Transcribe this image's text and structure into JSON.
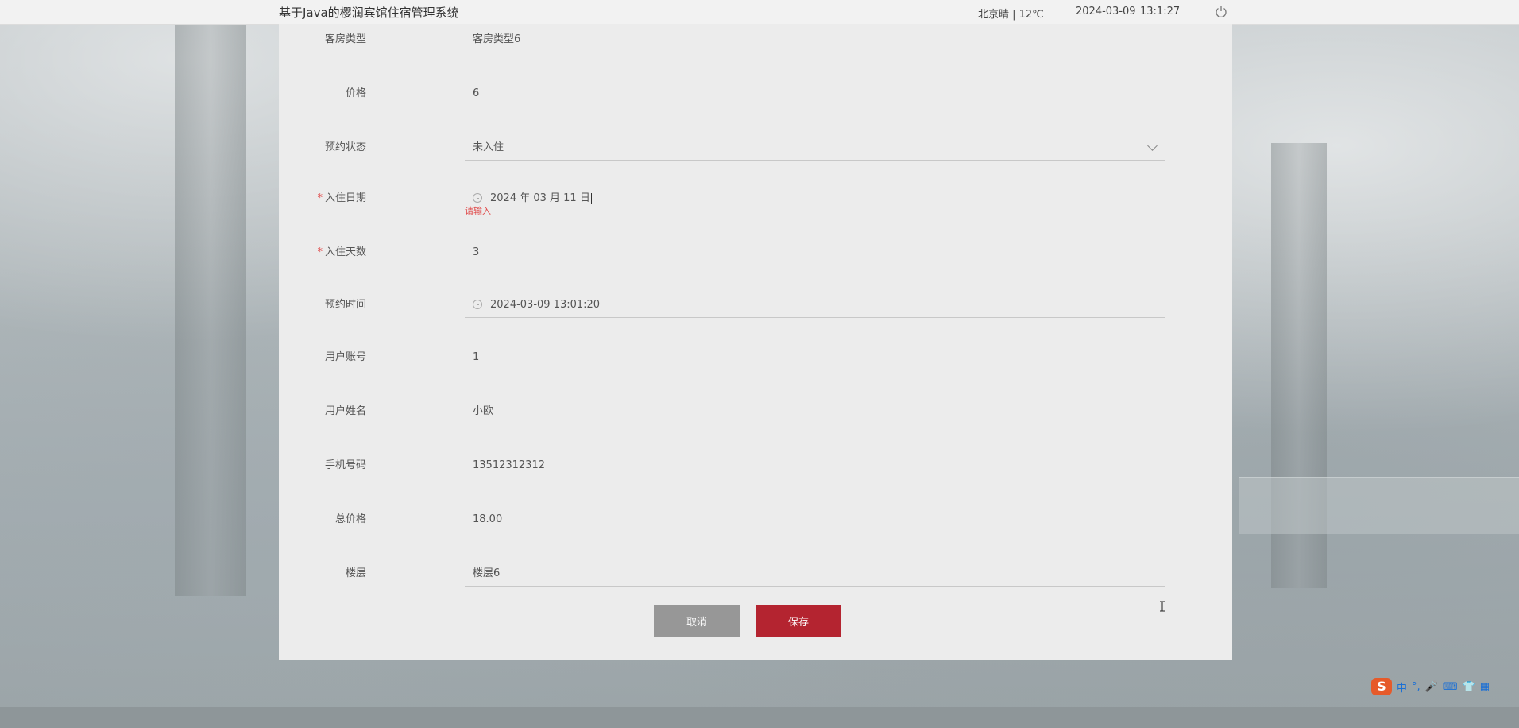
{
  "header": {
    "title": "基于Java的樱润宾馆住宿管理系统",
    "weather": "北京晴 | 12℃",
    "date": "2024-03-09",
    "time": "13:1:27"
  },
  "form": {
    "fields": [
      {
        "label": "客房类型",
        "value": "客房类型6",
        "required": false
      },
      {
        "label": "价格",
        "value": "6",
        "required": false
      },
      {
        "label": "预约状态",
        "value": "未入住",
        "required": false
      },
      {
        "label": "入住日期",
        "value": "2024 年 03 月 11 日",
        "required": true
      },
      {
        "label": "入住天数",
        "value": "3",
        "required": true
      },
      {
        "label": "预约时间",
        "value": "2024-03-09 13:01:20",
        "required": false
      },
      {
        "label": "用户账号",
        "value": "1",
        "required": false
      },
      {
        "label": "用户姓名",
        "value": "小欧",
        "required": false
      },
      {
        "label": "手机号码",
        "value": "13512312312",
        "required": false
      },
      {
        "label": "总价格",
        "value": "18.00",
        "required": false
      },
      {
        "label": "楼层",
        "value": "楼层6",
        "required": false
      }
    ],
    "error_message": "请输入",
    "required_mark": "*"
  },
  "buttons": {
    "cancel": "取消",
    "save": "保存"
  },
  "ime": {
    "logo": "S",
    "items": [
      "中",
      "°,",
      "🎤",
      "⌨",
      "👕",
      "▦"
    ]
  },
  "colors": {
    "save_button": "#b42430",
    "cancel_button": "#979797",
    "error": "#e04848",
    "panel": "#ececec"
  }
}
